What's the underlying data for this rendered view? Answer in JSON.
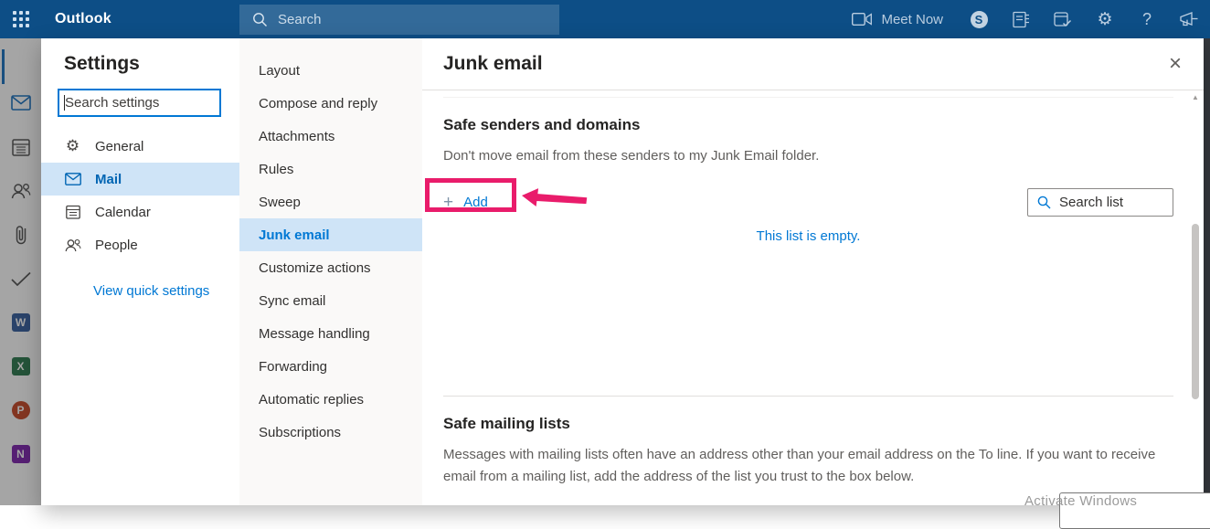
{
  "topbar": {
    "brand": "Outlook",
    "search_placeholder": "Search",
    "meet_now_label": "Meet Now",
    "skype_letter": "S"
  },
  "icons": {
    "gear": "⚙",
    "help": "?",
    "close": "×",
    "scroll_up": "▲",
    "plus": "+"
  },
  "rail": {
    "tiles": [
      {
        "name": "word",
        "letter": "W",
        "color": "#2b579a"
      },
      {
        "name": "excel",
        "letter": "X",
        "color": "#217346"
      },
      {
        "name": "powerpoint",
        "letter": "P",
        "color": "#c43e1c"
      },
      {
        "name": "onenote",
        "letter": "N",
        "color": "#7719aa"
      }
    ]
  },
  "settings_panel": {
    "title": "Settings",
    "search_placeholder": "Search settings",
    "items": [
      {
        "label": "General",
        "selected": false
      },
      {
        "label": "Mail",
        "selected": true
      },
      {
        "label": "Calendar",
        "selected": false
      },
      {
        "label": "People",
        "selected": false
      }
    ],
    "quick_link": "View quick settings"
  },
  "category_nav": {
    "items": [
      {
        "label": "Layout",
        "selected": false
      },
      {
        "label": "Compose and reply",
        "selected": false
      },
      {
        "label": "Attachments",
        "selected": false
      },
      {
        "label": "Rules",
        "selected": false
      },
      {
        "label": "Sweep",
        "selected": false
      },
      {
        "label": "Junk email",
        "selected": true
      },
      {
        "label": "Customize actions",
        "selected": false
      },
      {
        "label": "Sync email",
        "selected": false
      },
      {
        "label": "Message handling",
        "selected": false
      },
      {
        "label": "Forwarding",
        "selected": false
      },
      {
        "label": "Automatic replies",
        "selected": false
      },
      {
        "label": "Subscriptions",
        "selected": false
      }
    ]
  },
  "content": {
    "title": "Junk email",
    "safe_senders": {
      "heading": "Safe senders and domains",
      "description": "Don't move email from these senders to my Junk Email folder.",
      "add_label": "Add",
      "search_placeholder": "Search list",
      "empty_text": "This list is empty."
    },
    "safe_mailing": {
      "heading": "Safe mailing lists",
      "description": "Messages with mailing lists often have an address other than your email address on the To line. If you want to receive email from a mailing list, add the address of the list you trust to the box below."
    }
  },
  "watermark_text": "Activate Windows",
  "colors": {
    "topbar": "#0d4e86",
    "accent": "#0078d4",
    "selected_bg": "#cfe4f7",
    "annotation": "#e91c6b",
    "heading_text": "#252423",
    "body_text": "#605e5c"
  }
}
